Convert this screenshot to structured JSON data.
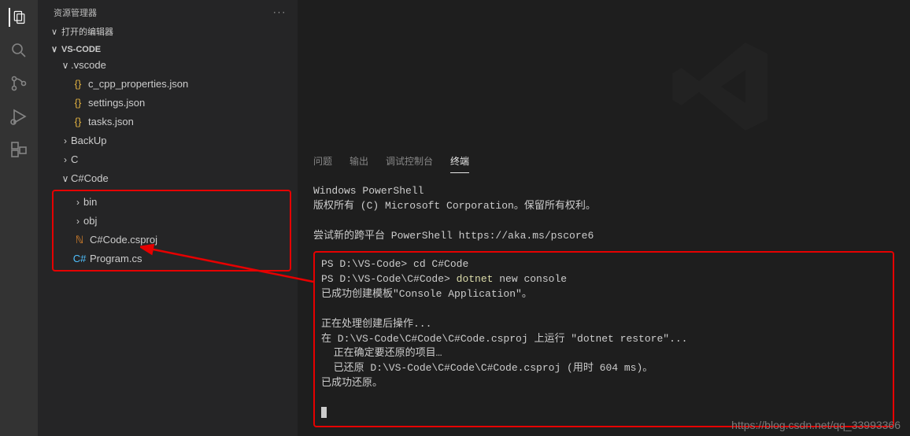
{
  "sidebar": {
    "title": "资源管理器",
    "open_editors": "打开的编辑器",
    "root": "VS-CODE",
    "vscode": ".vscode",
    "files_vscode": [
      {
        "label": "c_cpp_properties.json"
      },
      {
        "label": "settings.json"
      },
      {
        "label": "tasks.json"
      }
    ],
    "folders_root": [
      {
        "label": "BackUp"
      },
      {
        "label": "C"
      }
    ],
    "csharp_folder": "C#Code",
    "csharp_children": [
      {
        "label": "bin",
        "type": "folder"
      },
      {
        "label": "obj",
        "type": "folder"
      },
      {
        "label": "C#Code.csproj",
        "type": "csproj"
      },
      {
        "label": "Program.cs",
        "type": "cs"
      }
    ]
  },
  "panel": {
    "tabs": {
      "problems": "问题",
      "output": "输出",
      "debug": "调试控制台",
      "terminal": "终端"
    }
  },
  "terminal": {
    "line1": "Windows PowerShell",
    "line2": "版权所有 (C) Microsoft Corporation。保留所有权利。",
    "line3": "尝试新的跨平台 PowerShell https://aka.ms/pscore6",
    "prompt1": "PS D:\\VS-Code> ",
    "cmd1": "cd C#Code",
    "prompt2": "PS D:\\VS-Code\\C#Code> ",
    "cmd2a": "dotnet",
    "cmd2b": " new console",
    "out1": "已成功创建模板\"Console Application\"。",
    "out2": "正在处理创建后操作...",
    "out3": "在 D:\\VS-Code\\C#Code\\C#Code.csproj 上运行 \"dotnet restore\"...",
    "out4": "  正在确定要还原的项目…",
    "out5": "  已还原 D:\\VS-Code\\C#Code\\C#Code.csproj (用时 604 ms)。",
    "out6": "已成功还原。"
  },
  "watermark": "https://blog.csdn.net/qq_33993366"
}
